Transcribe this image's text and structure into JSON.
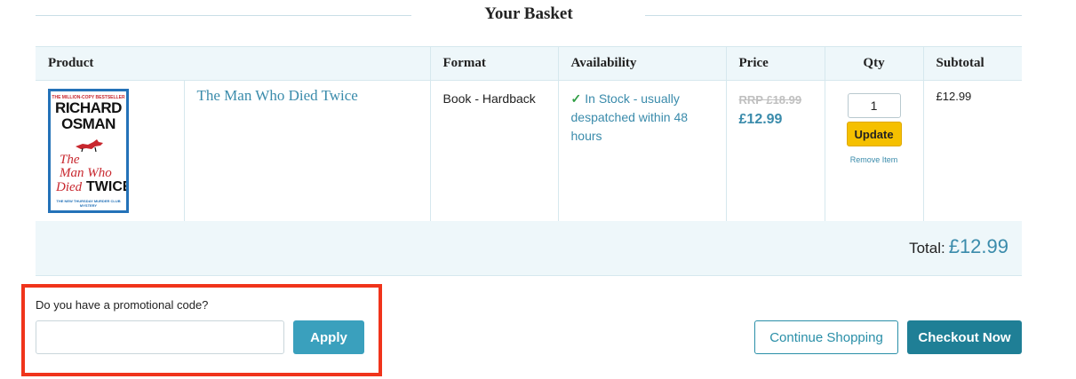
{
  "page": {
    "title": "Your Basket"
  },
  "table": {
    "headers": [
      "Product",
      "Format",
      "Availability",
      "Price",
      "Qty",
      "Subtotal"
    ],
    "row": {
      "product_title": "The Man Who Died Twice",
      "cover": {
        "tagline": "THE MILLION-COPY BESTSELLER",
        "author_first": "RICHARD",
        "author_last": "OSMAN",
        "title_line1": "The",
        "title_line2": "Man Who",
        "title_line3": "Died",
        "title_line4": "TWICE",
        "series": "THE NEW THURSDAY MURDER CLUB MYSTERY"
      },
      "format": "Book - Hardback",
      "availability": "In Stock - usually despatched within 48 hours",
      "availability_icon": "check-icon",
      "rrp": "RRP £18.99",
      "price": "£12.99",
      "qty": "1",
      "update_label": "Update",
      "remove_label": "Remove Item",
      "subtotal": "£12.99"
    }
  },
  "total": {
    "label": "Total:",
    "value": "£12.99"
  },
  "promo": {
    "label": "Do you have a promotional code?",
    "input_value": "",
    "apply_label": "Apply"
  },
  "actions": {
    "continue_label": "Continue Shopping",
    "checkout_label": "Checkout Now"
  },
  "colors": {
    "accent": "#3a8bab",
    "update_button": "#f5c000",
    "checkout_button": "#1f7f96",
    "highlight_box": "#f0341b"
  }
}
